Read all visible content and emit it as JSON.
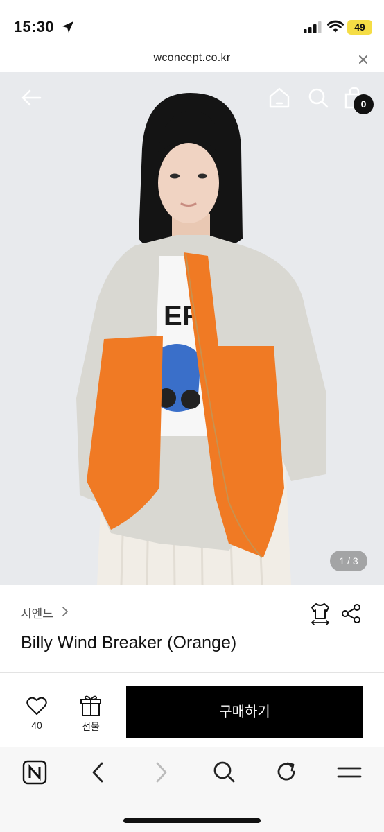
{
  "status_bar": {
    "time": "15:30",
    "battery": "49",
    "icons": [
      "location-arrow-icon",
      "signal-bars-icon",
      "wifi-icon",
      "battery-icon"
    ]
  },
  "browser": {
    "url": "wconcept.co.kr",
    "close_icon": "close-icon"
  },
  "hero": {
    "image_counter": "1 / 3",
    "cart_count": "0",
    "icons": [
      "back-arrow-icon",
      "home-icon",
      "search-icon",
      "shopping-bag-icon"
    ]
  },
  "product": {
    "brand": "시엔느",
    "title": "Billy Wind Breaker (Orange)",
    "icons": [
      "size-guide-icon",
      "share-icon"
    ]
  },
  "actions": {
    "like_count": "40",
    "gift_label": "선물",
    "buy_label": "구매하기"
  },
  "toolbar": {
    "icons": [
      "naver-n-icon",
      "back-icon",
      "forward-icon",
      "search-icon",
      "reload-icon",
      "menu-icon"
    ]
  },
  "colors": {
    "accent_orange": "#f07a24",
    "buy_button": "#000000",
    "battery_yellow": "#f5dd45"
  }
}
